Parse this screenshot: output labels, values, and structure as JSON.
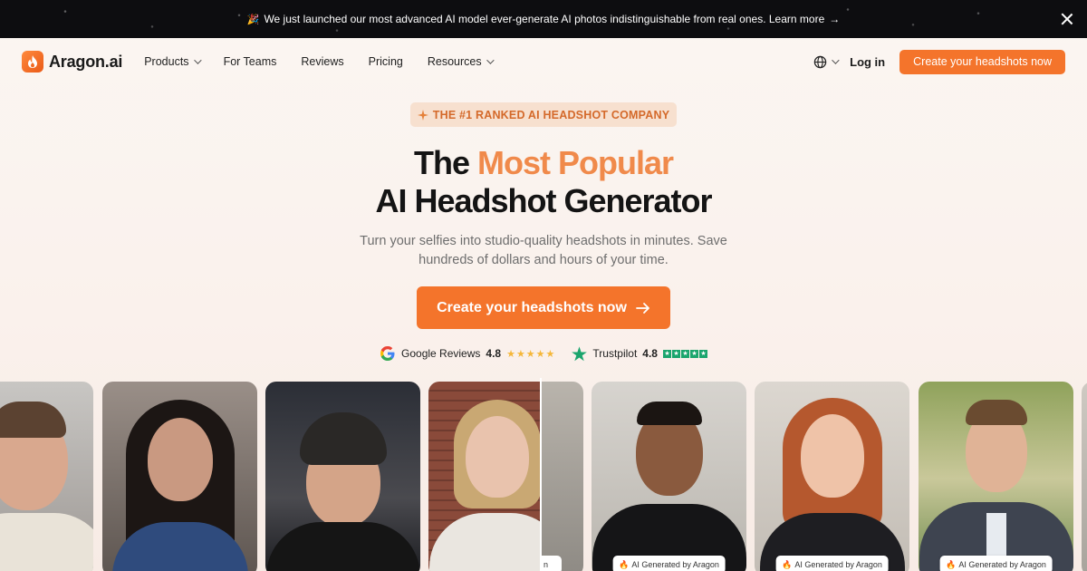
{
  "announcement": {
    "text": "We just launched our most advanced AI model ever-generate AI photos indistinguishable from real ones. Learn more"
  },
  "nav": {
    "brand": "Aragon.ai",
    "links": [
      {
        "label": "Products",
        "dropdown": true
      },
      {
        "label": "For Teams",
        "dropdown": false
      },
      {
        "label": "Reviews",
        "dropdown": false
      },
      {
        "label": "Pricing",
        "dropdown": false
      },
      {
        "label": "Resources",
        "dropdown": true
      }
    ],
    "login": "Log in",
    "cta": "Create your headshots now"
  },
  "hero": {
    "badge": "THE #1 RANKED AI HEADSHOT COMPANY",
    "headline_prefix": "The ",
    "headline_accent": "Most Popular",
    "headline_line2": "AI Headshot Generator",
    "subtitle": "Turn your selfies into studio-quality headshots in minutes. Save hundreds of dollars and hours of your time.",
    "cta": "Create your headshots now"
  },
  "ratings": {
    "google": {
      "label": "Google Reviews",
      "score": "4.8"
    },
    "trustpilot": {
      "label": "Trustpilot",
      "score": "4.8"
    }
  },
  "gallery": {
    "tag_label": "AI Generated by Aragon",
    "partial_tag_label": "n"
  },
  "colors": {
    "accent": "#f4742b",
    "accent_soft": "#f08a4b",
    "announcement_bg": "#0d0d10"
  }
}
